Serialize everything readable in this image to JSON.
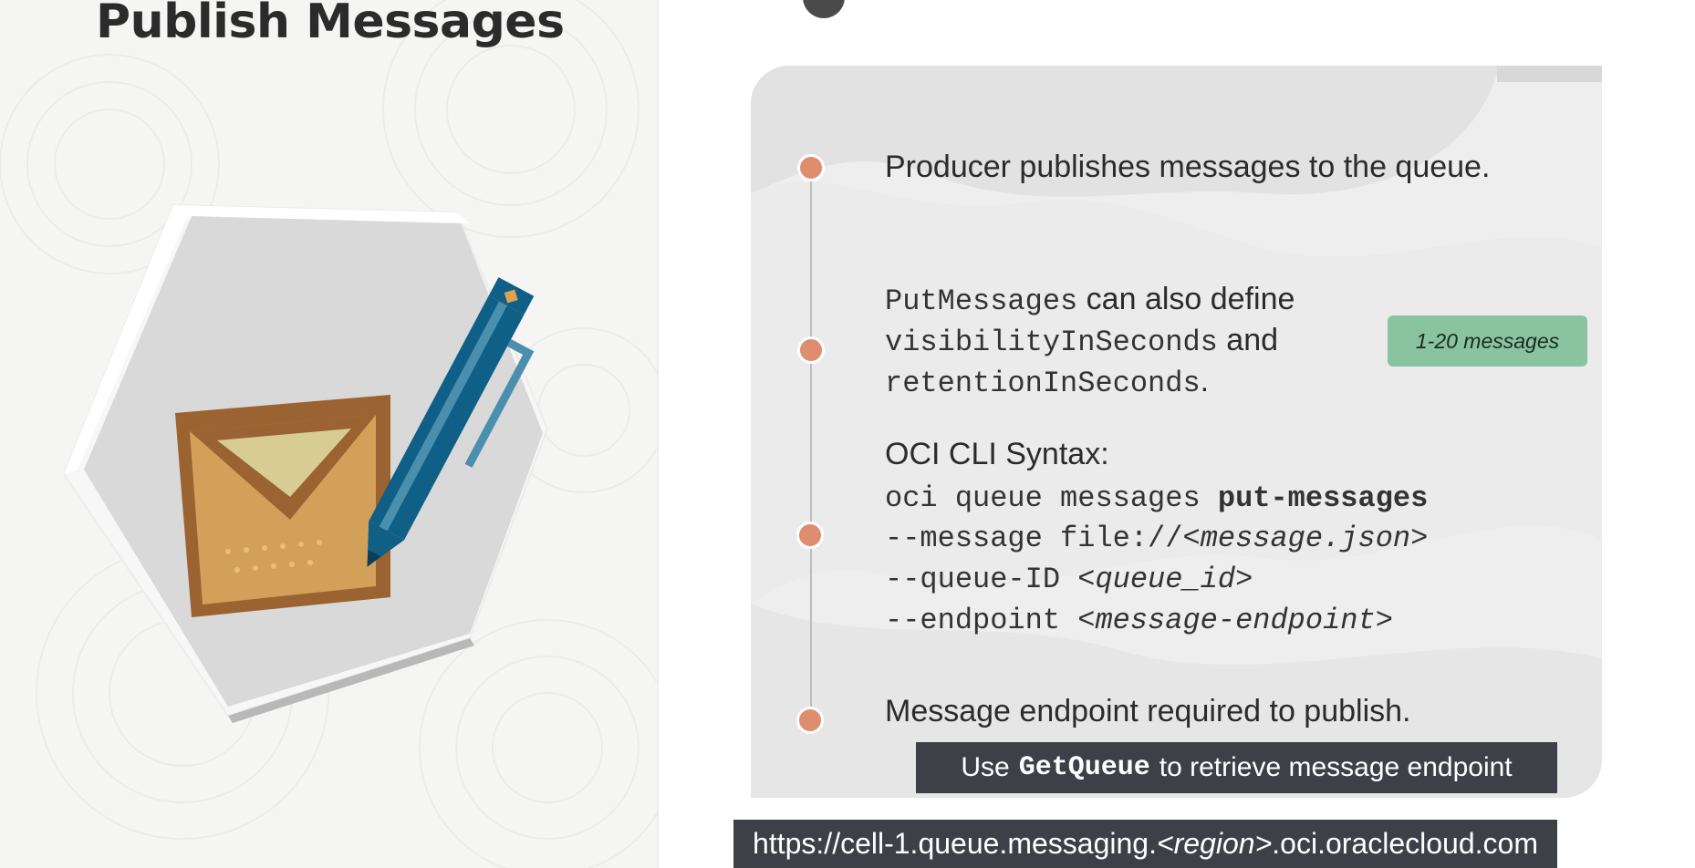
{
  "slide": {
    "title": "Publish Messages"
  },
  "icon": {
    "name": "envelope-pencil-icon",
    "colors": {
      "envelope": "#b07a3e",
      "pencil": "#0f5f86",
      "hexagon": "#d9d9d9"
    }
  },
  "timeline": {
    "accent": "#de8d6f",
    "items": [
      {
        "text": "Producer publishes messages to the queue."
      },
      {
        "line1_code": "PutMessages",
        "line1_text": " can also define",
        "line2_code": "visibilityInSeconds",
        "line2_text": " and",
        "line3_code": "retentionInSeconds",
        "line3_text": "."
      },
      {
        "heading": "OCI CLI Syntax:",
        "cmd_prefix": "oci queue messages ",
        "cmd_bold": "put-messages",
        "opt1_flag": "--message file://",
        "opt1_arg": "<message.json>",
        "opt2_flag": "--queue-ID ",
        "opt2_arg": "<queue_id>",
        "opt3_flag": "--endpoint ",
        "opt3_arg": "<message-endpoint>"
      },
      {
        "text": "Message endpoint required to publish."
      }
    ]
  },
  "badge": {
    "label": "1-20 messages",
    "color": "#89c3a0"
  },
  "getqueue_note": {
    "prefix": "Use",
    "code": "GetQueue",
    "suffix": "to retrieve message endpoint"
  },
  "endpoint_url": {
    "prefix": "https://cell-1.queue.messaging.",
    "region": "<region>",
    "suffix": ".oci.oraclecloud.com"
  }
}
